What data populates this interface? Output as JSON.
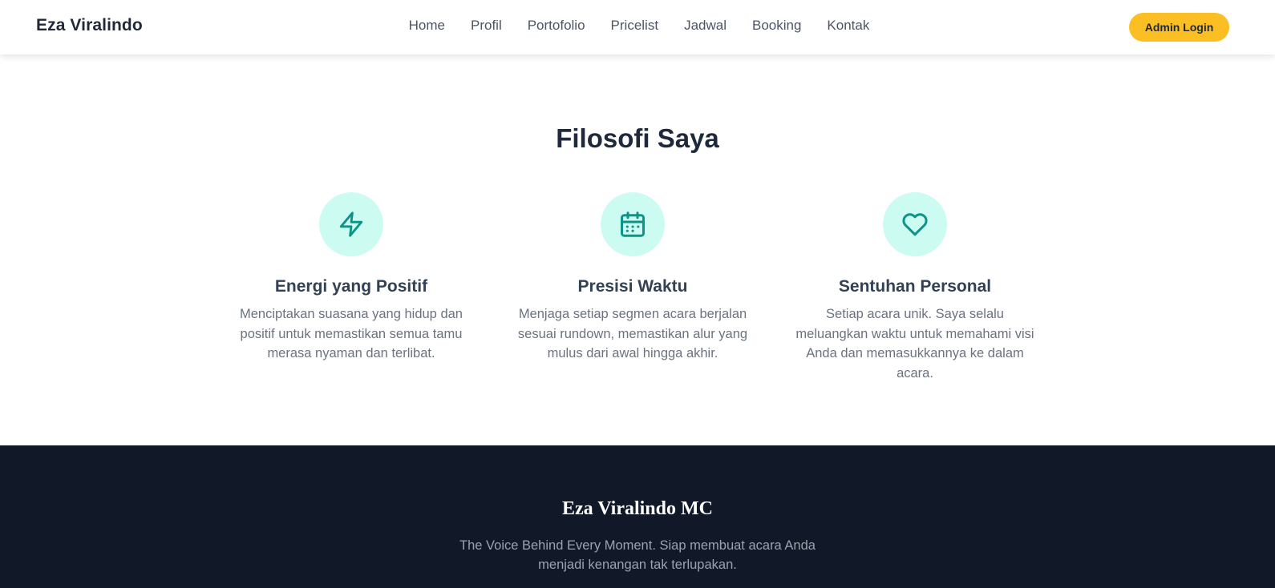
{
  "navbar": {
    "brand": "Eza Viralindo",
    "links": [
      "Home",
      "Profil",
      "Portofolio",
      "Pricelist",
      "Jadwal",
      "Booking",
      "Kontak"
    ],
    "admin_button": "Admin Login"
  },
  "philosophy": {
    "title": "Filosofi Saya",
    "features": [
      {
        "icon": "lightning-icon",
        "title": "Energi yang Positif",
        "description": "Menciptakan suasana yang hidup dan positif untuk memastikan semua tamu merasa nyaman dan terlibat."
      },
      {
        "icon": "calendar-icon",
        "title": "Presisi Waktu",
        "description": "Menjaga setiap segmen acara berjalan sesuai rundown, memastikan alur yang mulus dari awal hingga akhir."
      },
      {
        "icon": "heart-icon",
        "title": "Sentuhan Personal",
        "description": "Setiap acara unik. Saya selalu meluangkan waktu untuk memahami visi Anda dan memasukkannya ke dalam acara."
      }
    ]
  },
  "footer": {
    "title": "Eza Viralindo MC",
    "tagline": "The Voice Behind Every Moment. Siap membuat acara Anda menjadi kenangan tak terlupakan."
  },
  "colors": {
    "accent": "#fbbf24",
    "icon_bg": "#ccfbf1",
    "icon_stroke": "#0d9488",
    "footer_bg": "#111827",
    "heading": "#1e293b"
  }
}
